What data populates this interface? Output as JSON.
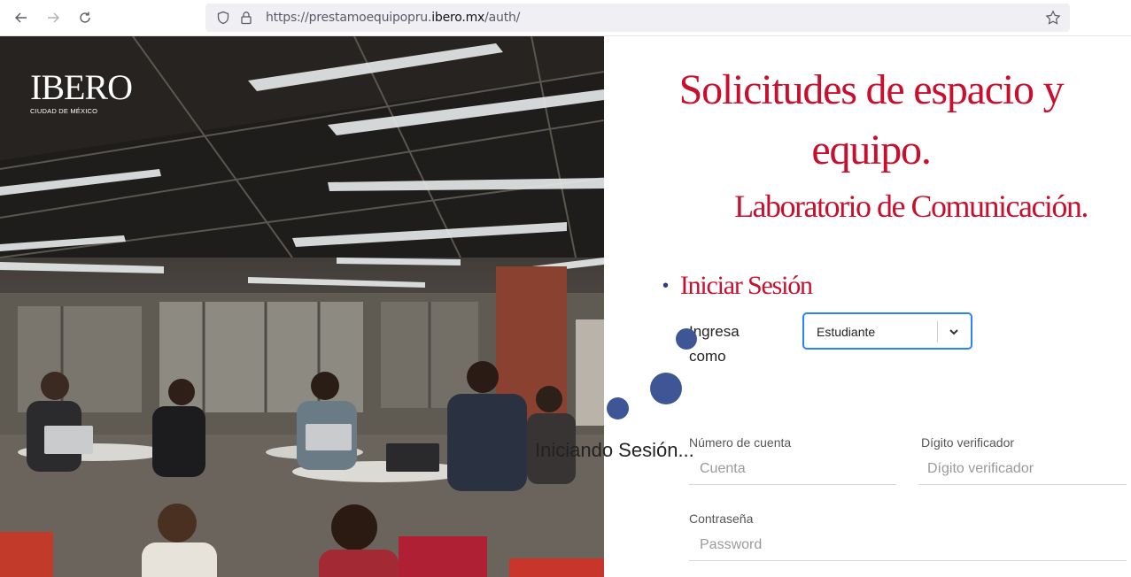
{
  "browser": {
    "url_prefix": "https://prestamoequipopru.",
    "url_domain": "ibero.mx",
    "url_path": "/auth/"
  },
  "brand": {
    "logo_word": "IBERO",
    "logo_sub": "CIUDAD DE MÉXICO"
  },
  "page": {
    "title_line1": "Solicitudes de espacio y",
    "title_line2": "equipo.",
    "subtitle": "Laboratorio de Comunicación.",
    "login_heading": "Iniciar Sesión"
  },
  "form": {
    "role_label": "Ingresa como",
    "role_selected": "Estudiante",
    "account_label": "Número de cuenta",
    "account_placeholder": "Cuenta",
    "check_digit_label": "Dígito verificador",
    "check_digit_placeholder": "Dígito verificador",
    "password_label": "Contraseña",
    "password_placeholder": "Password"
  },
  "overlay": {
    "loading_text": "Iniciando Sesión..."
  },
  "colors": {
    "brand_red": "#c8102e",
    "spinner_blue": "#3f5696",
    "focus_blue": "#2684ff"
  },
  "icons": [
    "back-arrow-icon",
    "forward-arrow-icon",
    "reload-icon",
    "shield-icon",
    "lock-icon",
    "bookmark-star-icon",
    "chevron-down-icon"
  ]
}
